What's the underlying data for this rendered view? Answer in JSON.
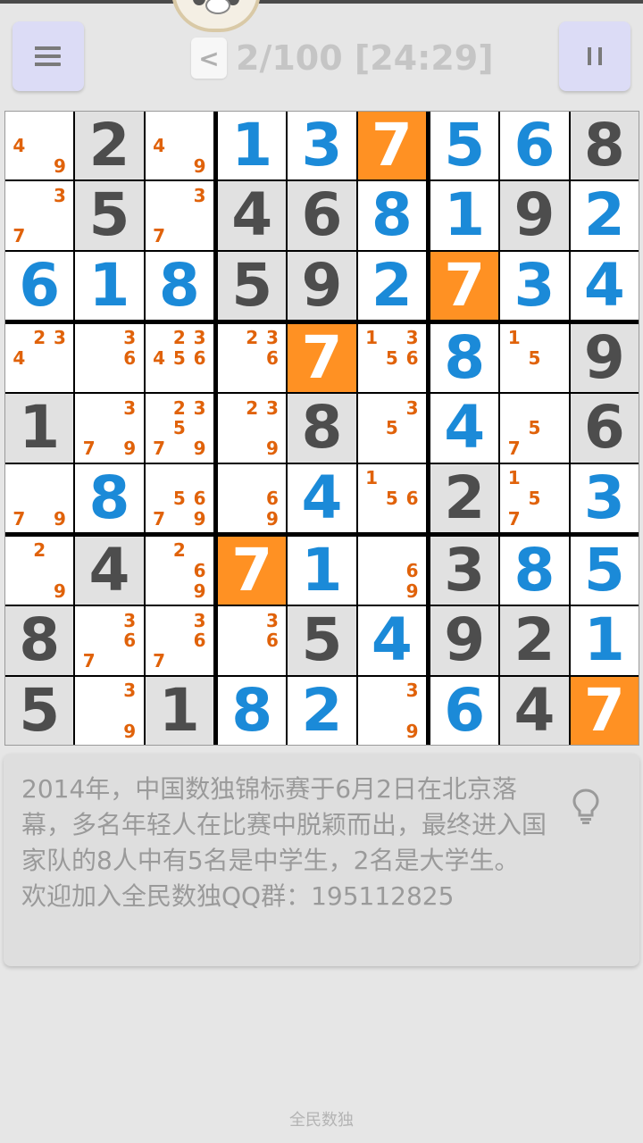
{
  "header": {
    "menu_icon": "menu-list-icon",
    "pause_icon": "pause-icon",
    "prev_label": "<",
    "level_text": "2/100 [24:29]"
  },
  "colors": {
    "given_bg": "#e1e1e1",
    "given_digit": "#4d4d4d",
    "user_digit": "#1b8ad8",
    "highlight_bg": "#ff9123",
    "note_color": "#e0620a"
  },
  "board": {
    "rows": [
      [
        {
          "notes": [
            4,
            9
          ]
        },
        {
          "v": "2",
          "t": "given"
        },
        {
          "notes": [
            4,
            9
          ]
        },
        {
          "v": "1",
          "t": "user"
        },
        {
          "v": "3",
          "t": "user"
        },
        {
          "v": "7",
          "t": "hl"
        },
        {
          "v": "5",
          "t": "user"
        },
        {
          "v": "6",
          "t": "user"
        },
        {
          "v": "8",
          "t": "given"
        }
      ],
      [
        {
          "notes": [
            3,
            7
          ]
        },
        {
          "v": "5",
          "t": "given"
        },
        {
          "notes": [
            3,
            7
          ]
        },
        {
          "v": "4",
          "t": "given"
        },
        {
          "v": "6",
          "t": "given"
        },
        {
          "v": "8",
          "t": "user"
        },
        {
          "v": "1",
          "t": "user"
        },
        {
          "v": "9",
          "t": "given"
        },
        {
          "v": "2",
          "t": "user"
        }
      ],
      [
        {
          "v": "6",
          "t": "user"
        },
        {
          "v": "1",
          "t": "user"
        },
        {
          "v": "8",
          "t": "user"
        },
        {
          "v": "5",
          "t": "given"
        },
        {
          "v": "9",
          "t": "given"
        },
        {
          "v": "2",
          "t": "user"
        },
        {
          "v": "7",
          "t": "hl"
        },
        {
          "v": "3",
          "t": "user"
        },
        {
          "v": "4",
          "t": "user"
        }
      ],
      [
        {
          "notes": [
            2,
            3,
            4
          ]
        },
        {
          "notes": [
            3,
            6
          ]
        },
        {
          "notes": [
            2,
            3,
            4,
            5,
            6
          ]
        },
        {
          "notes": [
            2,
            3,
            6
          ]
        },
        {
          "v": "7",
          "t": "hl"
        },
        {
          "notes": [
            1,
            3,
            5,
            6
          ]
        },
        {
          "v": "8",
          "t": "user"
        },
        {
          "notes": [
            1,
            5
          ]
        },
        {
          "v": "9",
          "t": "given"
        }
      ],
      [
        {
          "v": "1",
          "t": "given"
        },
        {
          "notes": [
            3,
            7,
            9
          ]
        },
        {
          "notes": [
            2,
            3,
            5,
            7,
            9
          ]
        },
        {
          "notes": [
            2,
            3,
            9
          ]
        },
        {
          "v": "8",
          "t": "given"
        },
        {
          "notes": [
            3,
            5
          ]
        },
        {
          "v": "4",
          "t": "user"
        },
        {
          "notes": [
            5,
            7
          ]
        },
        {
          "v": "6",
          "t": "given"
        }
      ],
      [
        {
          "notes": [
            7,
            9
          ]
        },
        {
          "v": "8",
          "t": "user"
        },
        {
          "notes": [
            5,
            6,
            7,
            9
          ]
        },
        {
          "notes": [
            6,
            9
          ]
        },
        {
          "v": "4",
          "t": "user"
        },
        {
          "notes": [
            1,
            5,
            6
          ]
        },
        {
          "v": "2",
          "t": "given"
        },
        {
          "notes": [
            1,
            5,
            7
          ]
        },
        {
          "v": "3",
          "t": "user"
        }
      ],
      [
        {
          "notes": [
            2,
            9
          ]
        },
        {
          "v": "4",
          "t": "given"
        },
        {
          "notes": [
            2,
            6,
            9
          ]
        },
        {
          "v": "7",
          "t": "hl"
        },
        {
          "v": "1",
          "t": "user"
        },
        {
          "notes": [
            6,
            9
          ]
        },
        {
          "v": "3",
          "t": "given"
        },
        {
          "v": "8",
          "t": "user"
        },
        {
          "v": "5",
          "t": "user"
        }
      ],
      [
        {
          "v": "8",
          "t": "given"
        },
        {
          "notes": [
            3,
            6,
            7
          ]
        },
        {
          "notes": [
            3,
            6,
            7
          ]
        },
        {
          "notes": [
            3,
            6
          ]
        },
        {
          "v": "5",
          "t": "given"
        },
        {
          "v": "4",
          "t": "user"
        },
        {
          "v": "9",
          "t": "given"
        },
        {
          "v": "2",
          "t": "given"
        },
        {
          "v": "1",
          "t": "user"
        }
      ],
      [
        {
          "v": "5",
          "t": "given"
        },
        {
          "notes": [
            3,
            9
          ]
        },
        {
          "v": "1",
          "t": "given"
        },
        {
          "v": "8",
          "t": "user"
        },
        {
          "v": "2",
          "t": "user"
        },
        {
          "notes": [
            3,
            9
          ]
        },
        {
          "v": "6",
          "t": "user"
        },
        {
          "v": "4",
          "t": "given"
        },
        {
          "v": "7",
          "t": "hl"
        }
      ]
    ]
  },
  "tip": {
    "text": "2014年，中国数独锦标赛于6月2日在北京落幕，多名年轻人在比赛中脱颖而出，最终进入国家队的8人中有5名是中学生，2名是大学生。\n欢迎加入全民数独QQ群：195112825",
    "icon": "lightbulb-icon"
  },
  "footer": {
    "app_name": "全民数独"
  }
}
